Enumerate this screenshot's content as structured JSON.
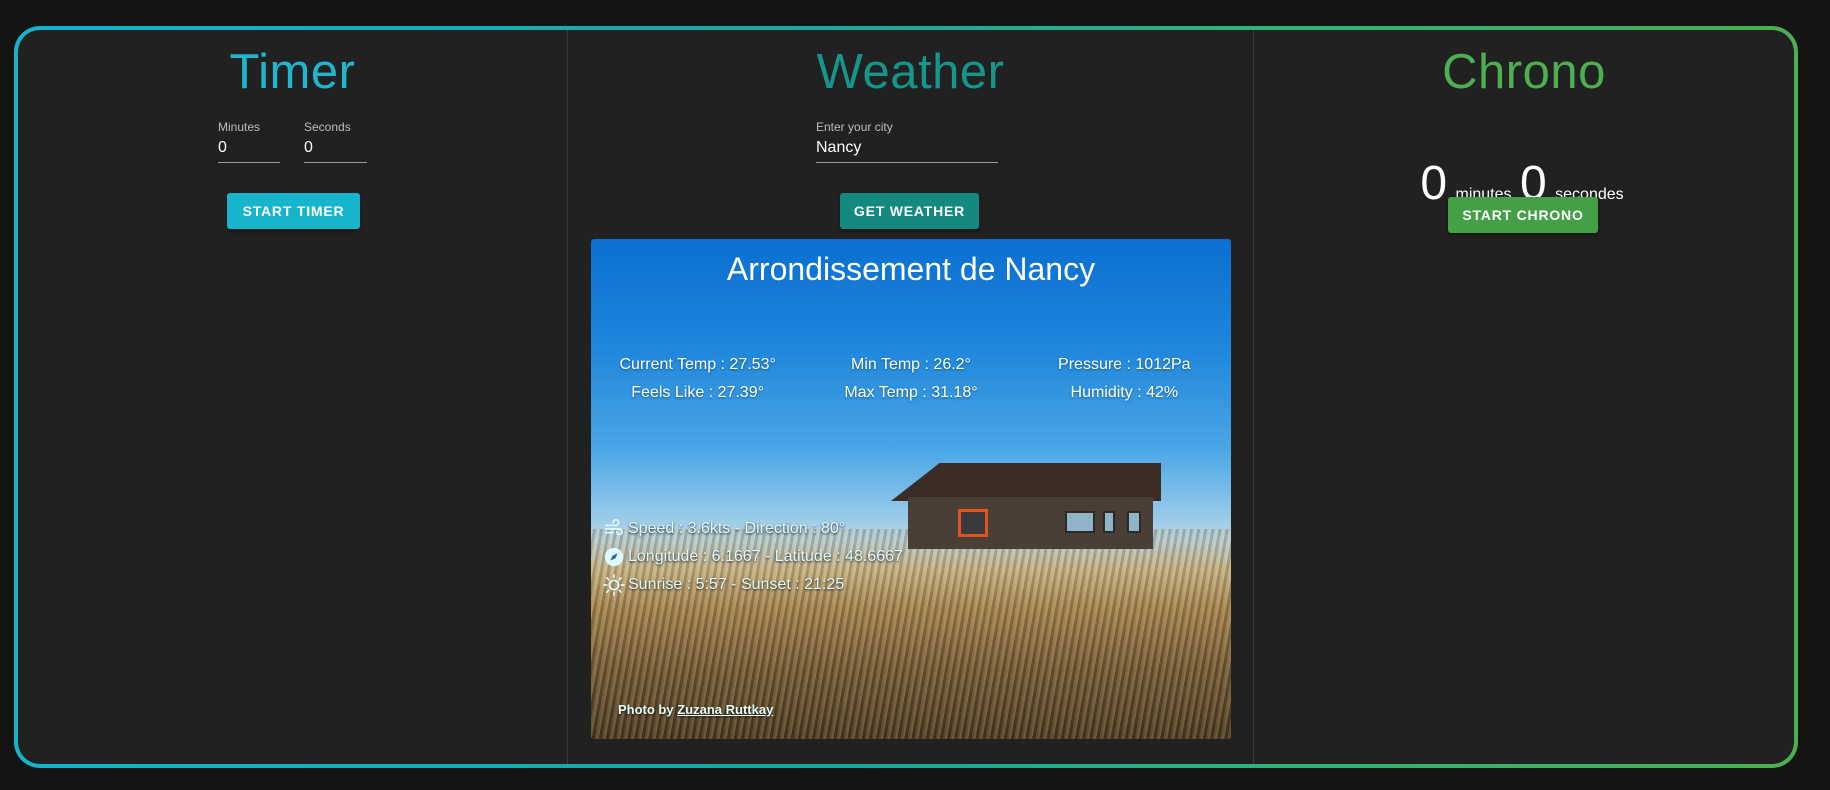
{
  "timer": {
    "title": "Timer",
    "minutes_label": "Minutes",
    "minutes_value": "0",
    "seconds_label": "Seconds",
    "seconds_value": "0",
    "start_button": "START TIMER"
  },
  "weather": {
    "title": "Weather",
    "city_label": "Enter your city",
    "city_value": "Nancy",
    "get_button": "GET WEATHER",
    "card": {
      "city_name": "Arrondissement de Nancy",
      "current_temp": "Current Temp : 27.53°",
      "feels_like": "Feels Like : 27.39°",
      "min_temp": "Min Temp : 26.2°",
      "max_temp": "Max Temp : 31.18°",
      "pressure": "Pressure : 1012Pa",
      "humidity": "Humidity : 42%",
      "wind": "Speed : 3.6kts - Direction : 80°",
      "coords": "Longitude : 6.1667 - Latitude : 48.6667",
      "sun": "Sunrise : 5:57 - Sunset : 21:25",
      "photo_by": "Photo by",
      "photographer": "Zuzana Ruttkay"
    }
  },
  "chrono": {
    "title": "Chrono",
    "minutes_value": "0",
    "minutes_unit": "minutes",
    "seconds_value": "0",
    "seconds_unit": "secondes",
    "start_button": "START CHRONO"
  },
  "colors": {
    "timer_accent": "#1db7cf",
    "weather_accent": "#14968a",
    "chrono_accent": "#4caf50",
    "panel_bg": "#212121"
  }
}
